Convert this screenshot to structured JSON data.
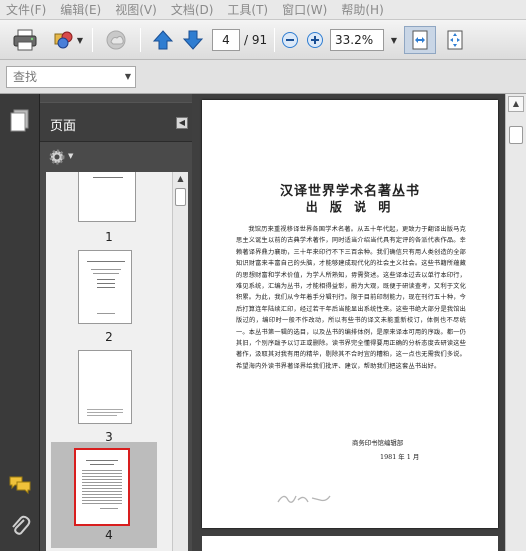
{
  "menu": {
    "items": [
      "文件(F)",
      "编辑(E)",
      "视图(V)",
      "文档(D)",
      "工具(T)",
      "窗口(W)",
      "帮助(H)"
    ]
  },
  "toolbar": {
    "page_current": "4",
    "page_total": "/ 91",
    "zoom": "33.2%",
    "icons": [
      "printer-icon",
      "share-icon",
      "disabled-cloud-icon",
      "prev-page-icon",
      "next-page-icon",
      "zoom-out-icon",
      "zoom-in-icon",
      "fit-width-icon",
      "fullscreen-icon"
    ],
    "accent": "#2f7dd1"
  },
  "search": {
    "placeholder": "查找"
  },
  "panel": {
    "title": "页面",
    "options_icon": "gear-icon",
    "thumbnails": [
      {
        "num": "1"
      },
      {
        "num": "2"
      },
      {
        "num": "3"
      },
      {
        "num": "4",
        "selected": true
      }
    ],
    "selection_color": "#d81e1e"
  },
  "rail": {
    "icons": [
      "pages-icon",
      "comments-icon",
      "attachments-icon"
    ]
  },
  "document": {
    "title": "汉译世界学术名著丛书",
    "subtitle": "出 版 说 明",
    "body": "我馆历来重视移译世界各国学术名著。从五十年代起，更致力于翻译出版马克思主义诞生以前的古典学术著作，同时适当介绍当代具有定评的各派代表作品。幸赖著译界鼎力襄助，三十年来印行不下三百余种。我们确信只有用人类创造的全部知识财富来丰富自己的头脑，才能够建成现代化的社会主义社会。这些书籍所蕴藏的思想财富和学术价值，为学人所熟知，毋需赘述。这些译本过去以单行本印行，难见系统，汇编为丛书，才能相得益彰，蔚为大观，既便于研读查考，又利于文化积累。为此，我们从今年着手分辑刊行。限于目前印制能力，现在刊行五十种，今后打算连年陆续汇印，经过若干年后当能显出系统性来。这些书绝大部分是我馆出版过的，编印时一般不作改动，所以有些书的译文未能重新校订，体例也不尽统一。本丛书第一辑的选目，以及丛书的编排体例，是原来译本可用的序跋。都一仍其旧，个别序跋予以订正或删除。读书界完全懂得要用正确的分析态度去研读这些著作，汲取其对我有用的精华，剔除其不合时宜的糟粕，这一点也无需我们多说。希望海内外读书界著译界给我们批评、建议，帮助我们把这套丛书出好。",
    "signature": "商务印书馆编辑部",
    "date": "1981 年 1 月"
  }
}
